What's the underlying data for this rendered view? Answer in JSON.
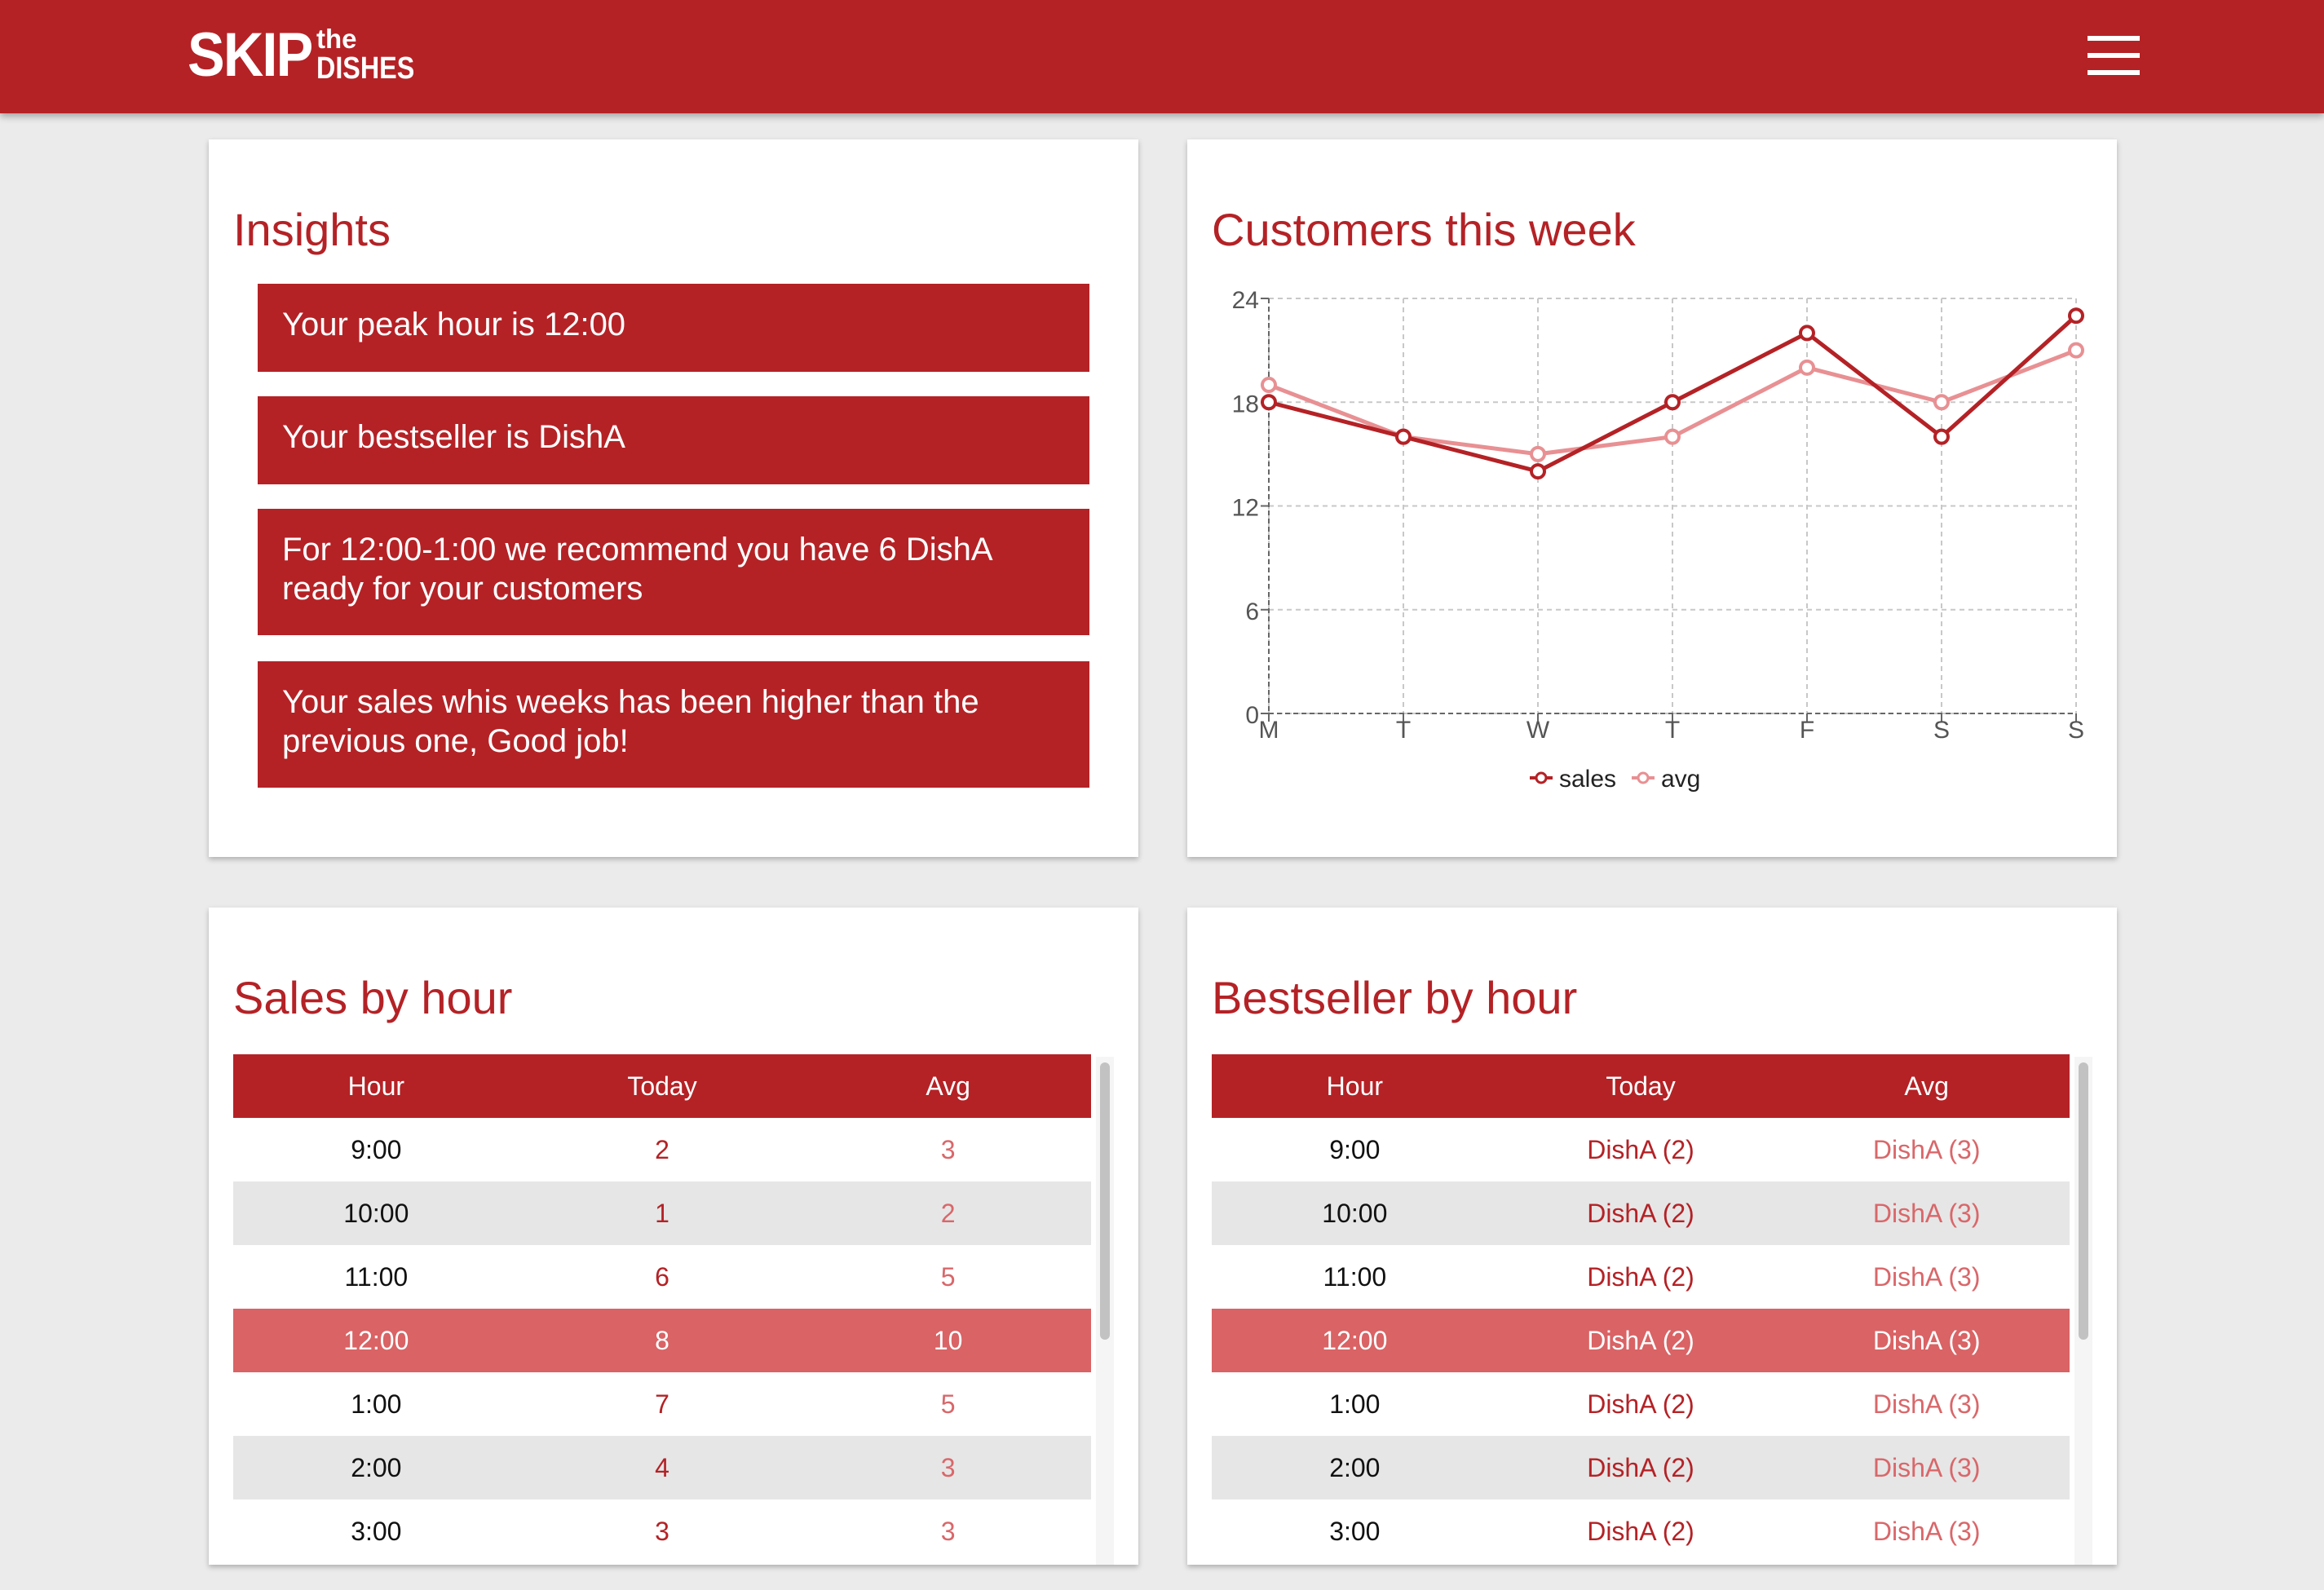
{
  "header": {
    "logo_main": "SKIP",
    "logo_the": "the",
    "logo_dishes": "DISHES"
  },
  "insights": {
    "title": "Insights",
    "items": [
      "Your peak hour is 12:00",
      "Your bestseller is DishA",
      "For 12:00-1:00 we recommend you have 6 DishA ready for your customers",
      "Your sales whis weeks has been higher than the previous one, Good job!"
    ]
  },
  "customers": {
    "title": "Customers this week"
  },
  "chart_data": {
    "type": "line",
    "categories": [
      "M",
      "T",
      "W",
      "T",
      "F",
      "S",
      "S"
    ],
    "series": [
      {
        "name": "sales",
        "values": [
          18,
          16,
          14,
          18,
          22,
          16,
          23
        ],
        "color": "#b42226"
      },
      {
        "name": "avg",
        "values": [
          19,
          16,
          15,
          16,
          20,
          18,
          21
        ],
        "color": "#e89093"
      }
    ],
    "yticks": [
      0,
      6,
      12,
      18,
      24
    ],
    "ylim": [
      0,
      24
    ],
    "grid": true,
    "legend": "bottom"
  },
  "sales_by_hour": {
    "title": "Sales by hour",
    "headers": [
      "Hour",
      "Today",
      "Avg"
    ],
    "rows": [
      [
        "9:00",
        "2",
        "3"
      ],
      [
        "10:00",
        "1",
        "2"
      ],
      [
        "11:00",
        "6",
        "5"
      ],
      [
        "12:00",
        "8",
        "10"
      ],
      [
        "1:00",
        "7",
        "5"
      ],
      [
        "2:00",
        "4",
        "3"
      ],
      [
        "3:00",
        "3",
        "3"
      ]
    ]
  },
  "bestseller_by_hour": {
    "title": "Bestseller by hour",
    "headers": [
      "Hour",
      "Today",
      "Avg"
    ],
    "rows": [
      [
        "9:00",
        "DishA (2)",
        "DishA (3)"
      ],
      [
        "10:00",
        "DishA (2)",
        "DishA (3)"
      ],
      [
        "11:00",
        "DishA (2)",
        "DishA (3)"
      ],
      [
        "12:00",
        "DishA (2)",
        "DishA (3)"
      ],
      [
        "1:00",
        "DishA (2)",
        "DishA (3)"
      ],
      [
        "2:00",
        "DishA (2)",
        "DishA (3)"
      ],
      [
        "3:00",
        "DishA (2)",
        "DishA (3)"
      ]
    ]
  },
  "highlight_row": 3
}
